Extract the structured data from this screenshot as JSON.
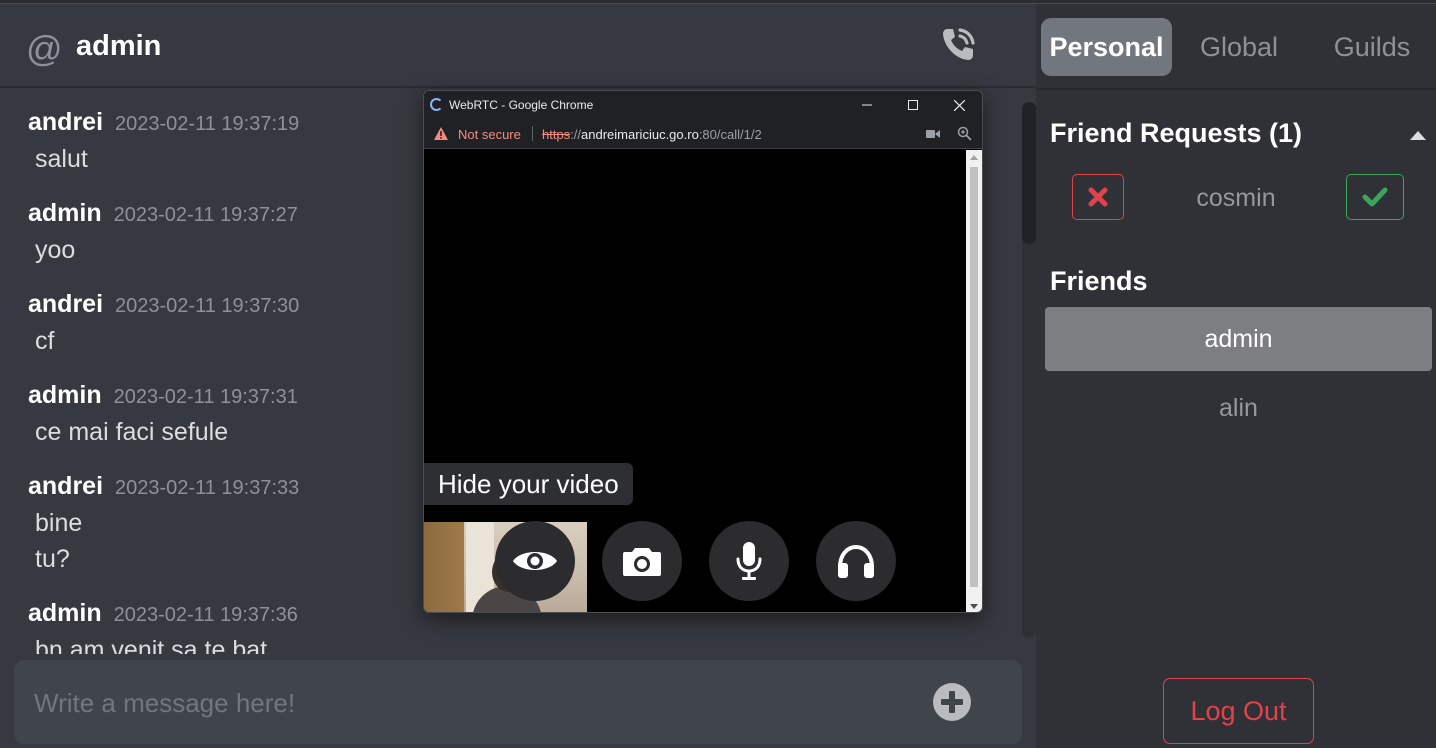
{
  "chat": {
    "at_symbol": "@",
    "title": "admin",
    "messages": [
      {
        "author": "andrei",
        "time": "2023-02-11 19:37:19",
        "lines": [
          "salut"
        ]
      },
      {
        "author": "admin",
        "time": "2023-02-11 19:37:27",
        "lines": [
          "yoo"
        ]
      },
      {
        "author": "andrei",
        "time": "2023-02-11 19:37:30",
        "lines": [
          "cf"
        ]
      },
      {
        "author": "admin",
        "time": "2023-02-11 19:37:31",
        "lines": [
          "ce mai faci sefule"
        ]
      },
      {
        "author": "andrei",
        "time": "2023-02-11 19:37:33",
        "lines": [
          "bine",
          "tu?"
        ]
      },
      {
        "author": "admin",
        "time": "2023-02-11 19:37:36",
        "lines": [
          "bn am venit sa te bat"
        ]
      }
    ],
    "composer_placeholder": "Write a message here!"
  },
  "panel": {
    "tabs": [
      "Personal",
      "Global",
      "Guilds"
    ],
    "active_tab": "Personal",
    "friend_requests_title": "Friend Requests (1)",
    "friend_requests": [
      {
        "name": "cosmin"
      }
    ],
    "friends_title": "Friends",
    "friends": [
      {
        "name": "admin",
        "selected": true
      },
      {
        "name": "alin",
        "selected": false
      }
    ],
    "logout_label": "Log Out"
  },
  "popup": {
    "window_title": "WebRTC - Google Chrome",
    "security_label": "Not secure",
    "url_scheme": "https",
    "url_sep": "://",
    "url_host": "andreimariciuc.go.ro",
    "url_rest": ":80/call/1/2",
    "tooltip": "Hide your video",
    "controls": [
      "eye-icon",
      "camera-icon",
      "microphone-icon",
      "headphones-icon"
    ]
  },
  "colors": {
    "danger": "#e0434b",
    "success": "#3ba55c",
    "background": "#36393f",
    "panel": "#2f3136"
  }
}
